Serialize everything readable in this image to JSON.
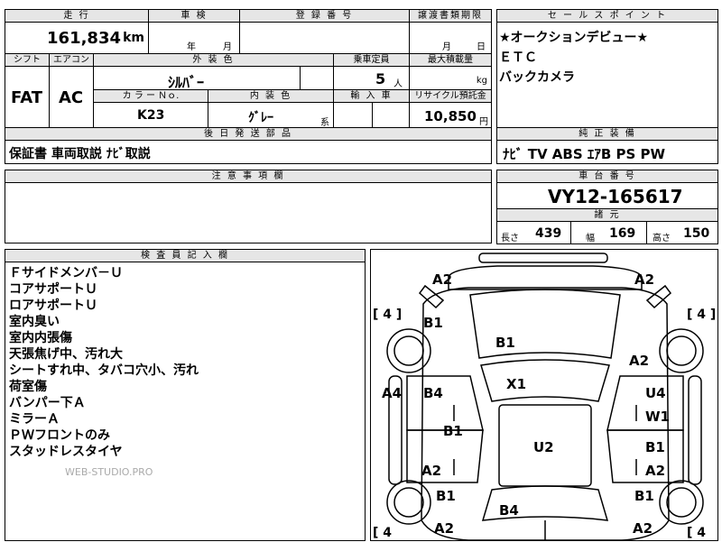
{
  "top": {
    "mileage_header": "走 行",
    "mileage_value": "161,834",
    "mileage_unit": "km",
    "inspection_header": "車 検",
    "inspection_year": "年",
    "inspection_month": "月",
    "registration_header": "登 録 番 号",
    "transfer_header": "譲渡書類期限",
    "transfer_month": "月",
    "transfer_day": "日"
  },
  "row2": {
    "shift_header": "シフト",
    "shift_value": "FAT",
    "aircon_header": "エアコン",
    "aircon_value": "AC",
    "exterior_header": "外 装 色",
    "exterior_value": "ｼﾙﾊﾞｰ",
    "capacity_header": "乗車定員",
    "capacity_value": "5",
    "capacity_unit": "人",
    "load_header": "最大積載量",
    "load_unit": "kg",
    "color_no_header": "カ ラ ー Ｎｏ.",
    "color_no_value": "K23",
    "interior_header": "内 装 色",
    "interior_value": "ｸﾞﾚｰ",
    "interior_suffix": "系",
    "import_header": "輸 入 車",
    "recycle_header": "リサイクル預託金",
    "recycle_value": "10,850",
    "recycle_unit": "円"
  },
  "selling_points": {
    "header": "セ ー ル ス ポ イ ン ト",
    "lines": [
      "★オークションデビュー★",
      "ＥＴＣ",
      "バックカメラ"
    ]
  },
  "later_parts": {
    "header": "後 日 発 送 部 品",
    "value": "保証書 車両取説 ﾅﾋﾞ取説"
  },
  "equipment": {
    "header": "純 正 装 備",
    "value": "ﾅﾋﾞ TV ABS ｴｱB PS PW"
  },
  "caution": {
    "header": "注 意 事 項 欄"
  },
  "chassis": {
    "header": "車 台 番 号",
    "value": "VY12-165617"
  },
  "specs": {
    "header": "諸 元",
    "length_label": "長さ",
    "length_value": "439",
    "width_label": "幅",
    "width_value": "169",
    "height_label": "高さ",
    "height_value": "150"
  },
  "inspector": {
    "header": "検 査 員 記 入 欄",
    "lines": [
      "Ｆサイドメンバ－Ｕ",
      "コアサポートＵ",
      "ロアサポートＵ",
      "室内臭い",
      "室内内張傷",
      "天張焦げ中、汚れ大",
      "シートすれ中、タバコ穴小、汚れ",
      "荷室傷",
      "バンパー下Ａ",
      "ミラーＡ",
      "ＰＷフロントのみ",
      "スタッドレスタイヤ"
    ],
    "watermark": "WEB-STUDIO.PRO"
  },
  "diagram": {
    "labels": {
      "front_left": "A2",
      "front_right": "A2",
      "hood": "B1",
      "left_front_fender": "B1",
      "right_front_fender": "A2",
      "windshield": "X1",
      "left_front_door": "B4",
      "left_side": "A4",
      "right_front_door_1": "U4",
      "right_front_door_2": "W1",
      "left_rear_door_mid": "B1",
      "roof": "U2",
      "right_rear_door": "B1",
      "left_rear_door": "A2",
      "right_rear_door_2": "A2",
      "left_rear_fender": "B1",
      "right_rear_fender": "B1",
      "trunk": "B4",
      "rear_left": "A2",
      "rear_right": "A2"
    },
    "tires": {
      "front_left": "[ 4 ]",
      "front_right": "[ 4 ]",
      "rear_left": "[ 4",
      "rear_right": "[ 4"
    }
  }
}
